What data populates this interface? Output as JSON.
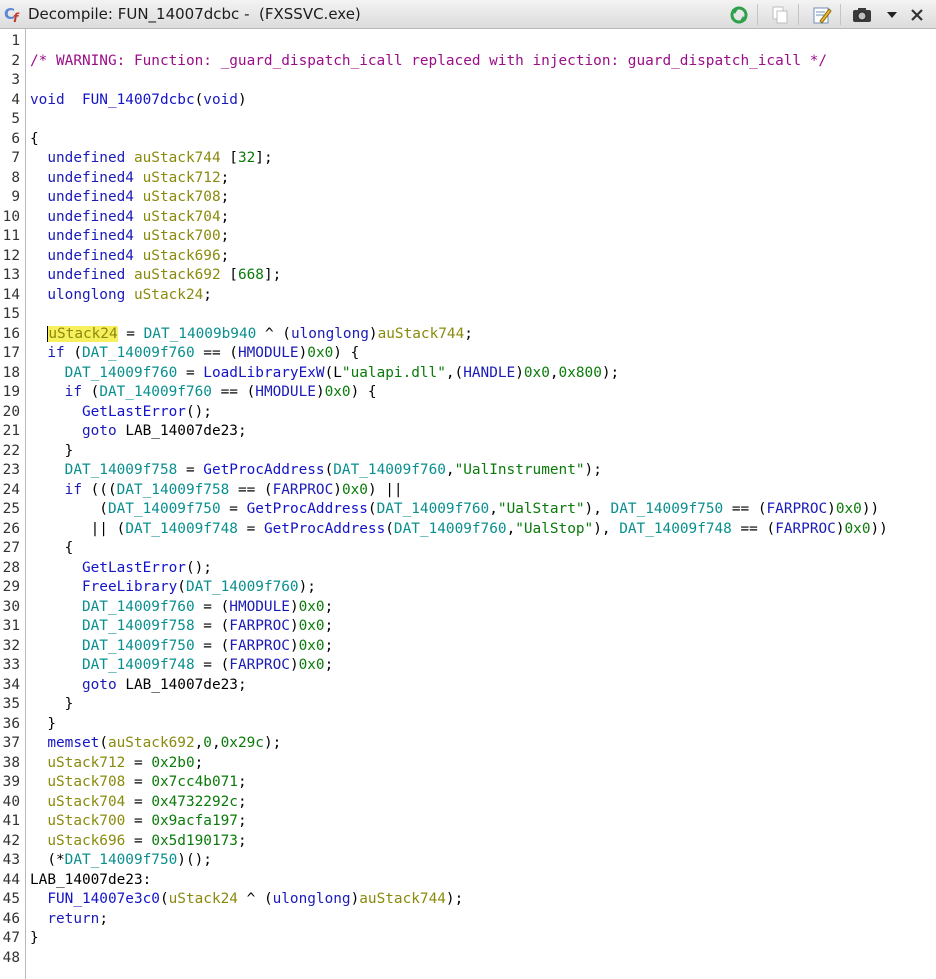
{
  "window": {
    "title": "Decompile: FUN_14007dcbc -  (FXSSVC.exe)",
    "app_icon_label": "C",
    "app_icon_sub": "f"
  },
  "toolbar": {
    "buttons": [
      {
        "name": "refresh-icon"
      },
      {
        "name": "copy-icon"
      },
      {
        "name": "edit-signature-icon"
      },
      {
        "name": "snapshot-icon"
      },
      {
        "name": "menu-chevron-icon"
      }
    ]
  },
  "code_lines": [
    [],
    [
      [
        "c-com",
        "/* WARNING: Function: _guard_dispatch_icall replaced with injection: guard_dispatch_icall */"
      ]
    ],
    [],
    [
      [
        "c-typ",
        "void"
      ],
      [
        "",
        "  "
      ],
      [
        "c-fn",
        "FUN_14007dcbc"
      ],
      [
        "",
        "("
      ],
      [
        "c-typ",
        "void"
      ],
      [
        "",
        ")"
      ]
    ],
    [],
    [
      [
        "",
        "{"
      ]
    ],
    [
      [
        "",
        "  "
      ],
      [
        "c-typ",
        "undefined"
      ],
      [
        "",
        " "
      ],
      [
        "c-var",
        "auStack744"
      ],
      [
        "",
        " ["
      ],
      [
        "c-num",
        "32"
      ],
      [
        "",
        "];"
      ]
    ],
    [
      [
        "",
        "  "
      ],
      [
        "c-typ",
        "undefined4"
      ],
      [
        "",
        " "
      ],
      [
        "c-var",
        "uStack712"
      ],
      [
        "",
        ";"
      ]
    ],
    [
      [
        "",
        "  "
      ],
      [
        "c-typ",
        "undefined4"
      ],
      [
        "",
        " "
      ],
      [
        "c-var",
        "uStack708"
      ],
      [
        "",
        ";"
      ]
    ],
    [
      [
        "",
        "  "
      ],
      [
        "c-typ",
        "undefined4"
      ],
      [
        "",
        " "
      ],
      [
        "c-var",
        "uStack704"
      ],
      [
        "",
        ";"
      ]
    ],
    [
      [
        "",
        "  "
      ],
      [
        "c-typ",
        "undefined4"
      ],
      [
        "",
        " "
      ],
      [
        "c-var",
        "uStack700"
      ],
      [
        "",
        ";"
      ]
    ],
    [
      [
        "",
        "  "
      ],
      [
        "c-typ",
        "undefined4"
      ],
      [
        "",
        " "
      ],
      [
        "c-var",
        "uStack696"
      ],
      [
        "",
        ";"
      ]
    ],
    [
      [
        "",
        "  "
      ],
      [
        "c-typ",
        "undefined"
      ],
      [
        "",
        " "
      ],
      [
        "c-var",
        "auStack692"
      ],
      [
        "",
        " ["
      ],
      [
        "c-num",
        "668"
      ],
      [
        "",
        "];"
      ]
    ],
    [
      [
        "",
        "  "
      ],
      [
        "c-typ",
        "ulonglong"
      ],
      [
        "",
        " "
      ],
      [
        "c-var",
        "uStack24"
      ],
      [
        "",
        ";"
      ]
    ],
    [],
    [
      [
        "",
        "  "
      ],
      [
        "c-var c-hl cursor",
        "uStack24"
      ],
      [
        "",
        " = "
      ],
      [
        "c-glob",
        "DAT_14009b940"
      ],
      [
        "",
        " ^ ("
      ],
      [
        "c-typ",
        "ulonglong"
      ],
      [
        "",
        ")"
      ],
      [
        "c-var",
        "auStack744"
      ],
      [
        "",
        ";"
      ]
    ],
    [
      [
        "",
        "  "
      ],
      [
        "c-kw",
        "if"
      ],
      [
        "",
        " ("
      ],
      [
        "c-glob",
        "DAT_14009f760"
      ],
      [
        "",
        " == ("
      ],
      [
        "c-typ",
        "HMODULE"
      ],
      [
        "",
        ")"
      ],
      [
        "c-num",
        "0x0"
      ],
      [
        "",
        ") {"
      ]
    ],
    [
      [
        "",
        "    "
      ],
      [
        "c-glob",
        "DAT_14009f760"
      ],
      [
        "",
        " = "
      ],
      [
        "c-fn",
        "LoadLibraryExW"
      ],
      [
        "",
        "(L"
      ],
      [
        "c-str",
        "\"ualapi.dll\""
      ],
      [
        "",
        ",("
      ],
      [
        "c-typ",
        "HANDLE"
      ],
      [
        "",
        ")"
      ],
      [
        "c-num",
        "0x0"
      ],
      [
        "",
        ","
      ],
      [
        "c-num",
        "0x800"
      ],
      [
        "",
        ");"
      ]
    ],
    [
      [
        "",
        "    "
      ],
      [
        "c-kw",
        "if"
      ],
      [
        "",
        " ("
      ],
      [
        "c-glob",
        "DAT_14009f760"
      ],
      [
        "",
        " == ("
      ],
      [
        "c-typ",
        "HMODULE"
      ],
      [
        "",
        ")"
      ],
      [
        "c-num",
        "0x0"
      ],
      [
        "",
        ") {"
      ]
    ],
    [
      [
        "",
        "      "
      ],
      [
        "c-fn",
        "GetLastError"
      ],
      [
        "",
        "();"
      ]
    ],
    [
      [
        "",
        "      "
      ],
      [
        "c-kw",
        "goto"
      ],
      [
        "",
        " "
      ],
      [
        "c-lab",
        "LAB_14007de23"
      ],
      [
        "",
        ";"
      ]
    ],
    [
      [
        "",
        "    }"
      ]
    ],
    [
      [
        "",
        "    "
      ],
      [
        "c-glob",
        "DAT_14009f758"
      ],
      [
        "",
        " = "
      ],
      [
        "c-fn",
        "GetProcAddress"
      ],
      [
        "",
        "("
      ],
      [
        "c-glob",
        "DAT_14009f760"
      ],
      [
        "",
        ","
      ],
      [
        "c-str",
        "\"UalInstrument\""
      ],
      [
        "",
        ");"
      ]
    ],
    [
      [
        "",
        "    "
      ],
      [
        "c-kw",
        "if"
      ],
      [
        "",
        " ((("
      ],
      [
        "c-glob",
        "DAT_14009f758"
      ],
      [
        "",
        " == ("
      ],
      [
        "c-typ",
        "FARPROC"
      ],
      [
        "",
        ")"
      ],
      [
        "c-num",
        "0x0"
      ],
      [
        "",
        ") ||"
      ]
    ],
    [
      [
        "",
        "        ("
      ],
      [
        "c-glob",
        "DAT_14009f750"
      ],
      [
        "",
        " = "
      ],
      [
        "c-fn",
        "GetProcAddress"
      ],
      [
        "",
        "("
      ],
      [
        "c-glob",
        "DAT_14009f760"
      ],
      [
        "",
        ","
      ],
      [
        "c-str",
        "\"UalStart\""
      ],
      [
        "",
        "), "
      ],
      [
        "c-glob",
        "DAT_14009f750"
      ],
      [
        "",
        " == ("
      ],
      [
        "c-typ",
        "FARPROC"
      ],
      [
        "",
        ")"
      ],
      [
        "c-num",
        "0x0"
      ],
      [
        "",
        "))"
      ]
    ],
    [
      [
        "",
        "       || ("
      ],
      [
        "c-glob",
        "DAT_14009f748"
      ],
      [
        "",
        " = "
      ],
      [
        "c-fn",
        "GetProcAddress"
      ],
      [
        "",
        "("
      ],
      [
        "c-glob",
        "DAT_14009f760"
      ],
      [
        "",
        ","
      ],
      [
        "c-str",
        "\"UalStop\""
      ],
      [
        "",
        "), "
      ],
      [
        "c-glob",
        "DAT_14009f748"
      ],
      [
        "",
        " == ("
      ],
      [
        "c-typ",
        "FARPROC"
      ],
      [
        "",
        ")"
      ],
      [
        "c-num",
        "0x0"
      ],
      [
        "",
        "))"
      ]
    ],
    [
      [
        "",
        "    {"
      ]
    ],
    [
      [
        "",
        "      "
      ],
      [
        "c-fn",
        "GetLastError"
      ],
      [
        "",
        "();"
      ]
    ],
    [
      [
        "",
        "      "
      ],
      [
        "c-fn",
        "FreeLibrary"
      ],
      [
        "",
        "("
      ],
      [
        "c-glob",
        "DAT_14009f760"
      ],
      [
        "",
        ");"
      ]
    ],
    [
      [
        "",
        "      "
      ],
      [
        "c-glob",
        "DAT_14009f760"
      ],
      [
        "",
        " = ("
      ],
      [
        "c-typ",
        "HMODULE"
      ],
      [
        "",
        ")"
      ],
      [
        "c-num",
        "0x0"
      ],
      [
        "",
        ";"
      ]
    ],
    [
      [
        "",
        "      "
      ],
      [
        "c-glob",
        "DAT_14009f758"
      ],
      [
        "",
        " = ("
      ],
      [
        "c-typ",
        "FARPROC"
      ],
      [
        "",
        ")"
      ],
      [
        "c-num",
        "0x0"
      ],
      [
        "",
        ";"
      ]
    ],
    [
      [
        "",
        "      "
      ],
      [
        "c-glob",
        "DAT_14009f750"
      ],
      [
        "",
        " = ("
      ],
      [
        "c-typ",
        "FARPROC"
      ],
      [
        "",
        ")"
      ],
      [
        "c-num",
        "0x0"
      ],
      [
        "",
        ";"
      ]
    ],
    [
      [
        "",
        "      "
      ],
      [
        "c-glob",
        "DAT_14009f748"
      ],
      [
        "",
        " = ("
      ],
      [
        "c-typ",
        "FARPROC"
      ],
      [
        "",
        ")"
      ],
      [
        "c-num",
        "0x0"
      ],
      [
        "",
        ";"
      ]
    ],
    [
      [
        "",
        "      "
      ],
      [
        "c-kw",
        "goto"
      ],
      [
        "",
        " "
      ],
      [
        "c-lab",
        "LAB_14007de23"
      ],
      [
        "",
        ";"
      ]
    ],
    [
      [
        "",
        "    }"
      ]
    ],
    [
      [
        "",
        "  }"
      ]
    ],
    [
      [
        "",
        "  "
      ],
      [
        "c-fn",
        "memset"
      ],
      [
        "",
        "("
      ],
      [
        "c-var",
        "auStack692"
      ],
      [
        "",
        ","
      ],
      [
        "c-num",
        "0"
      ],
      [
        "",
        ","
      ],
      [
        "c-num",
        "0x29c"
      ],
      [
        "",
        ");"
      ]
    ],
    [
      [
        "",
        "  "
      ],
      [
        "c-var",
        "uStack712"
      ],
      [
        "",
        " = "
      ],
      [
        "c-num",
        "0x2b0"
      ],
      [
        "",
        ";"
      ]
    ],
    [
      [
        "",
        "  "
      ],
      [
        "c-var",
        "uStack708"
      ],
      [
        "",
        " = "
      ],
      [
        "c-num",
        "0x7cc4b071"
      ],
      [
        "",
        ";"
      ]
    ],
    [
      [
        "",
        "  "
      ],
      [
        "c-var",
        "uStack704"
      ],
      [
        "",
        " = "
      ],
      [
        "c-num",
        "0x4732292c"
      ],
      [
        "",
        ";"
      ]
    ],
    [
      [
        "",
        "  "
      ],
      [
        "c-var",
        "uStack700"
      ],
      [
        "",
        " = "
      ],
      [
        "c-num",
        "0x9acfa197"
      ],
      [
        "",
        ";"
      ]
    ],
    [
      [
        "",
        "  "
      ],
      [
        "c-var",
        "uStack696"
      ],
      [
        "",
        " = "
      ],
      [
        "c-num",
        "0x5d190173"
      ],
      [
        "",
        ";"
      ]
    ],
    [
      [
        "",
        "  (*"
      ],
      [
        "c-glob",
        "DAT_14009f750"
      ],
      [
        "",
        ")();"
      ]
    ],
    [
      [
        "c-lab",
        "LAB_14007de23"
      ],
      [
        "",
        ":"
      ]
    ],
    [
      [
        "",
        "  "
      ],
      [
        "c-fn",
        "FUN_14007e3c0"
      ],
      [
        "",
        "("
      ],
      [
        "c-var",
        "uStack24"
      ],
      [
        "",
        " ^ ("
      ],
      [
        "c-typ",
        "ulonglong"
      ],
      [
        "",
        ")"
      ],
      [
        "c-var",
        "auStack744"
      ],
      [
        "",
        ");"
      ]
    ],
    [
      [
        "",
        "  "
      ],
      [
        "c-kw",
        "return"
      ],
      [
        "",
        ";"
      ]
    ],
    [
      [
        "",
        "}"
      ]
    ],
    []
  ]
}
